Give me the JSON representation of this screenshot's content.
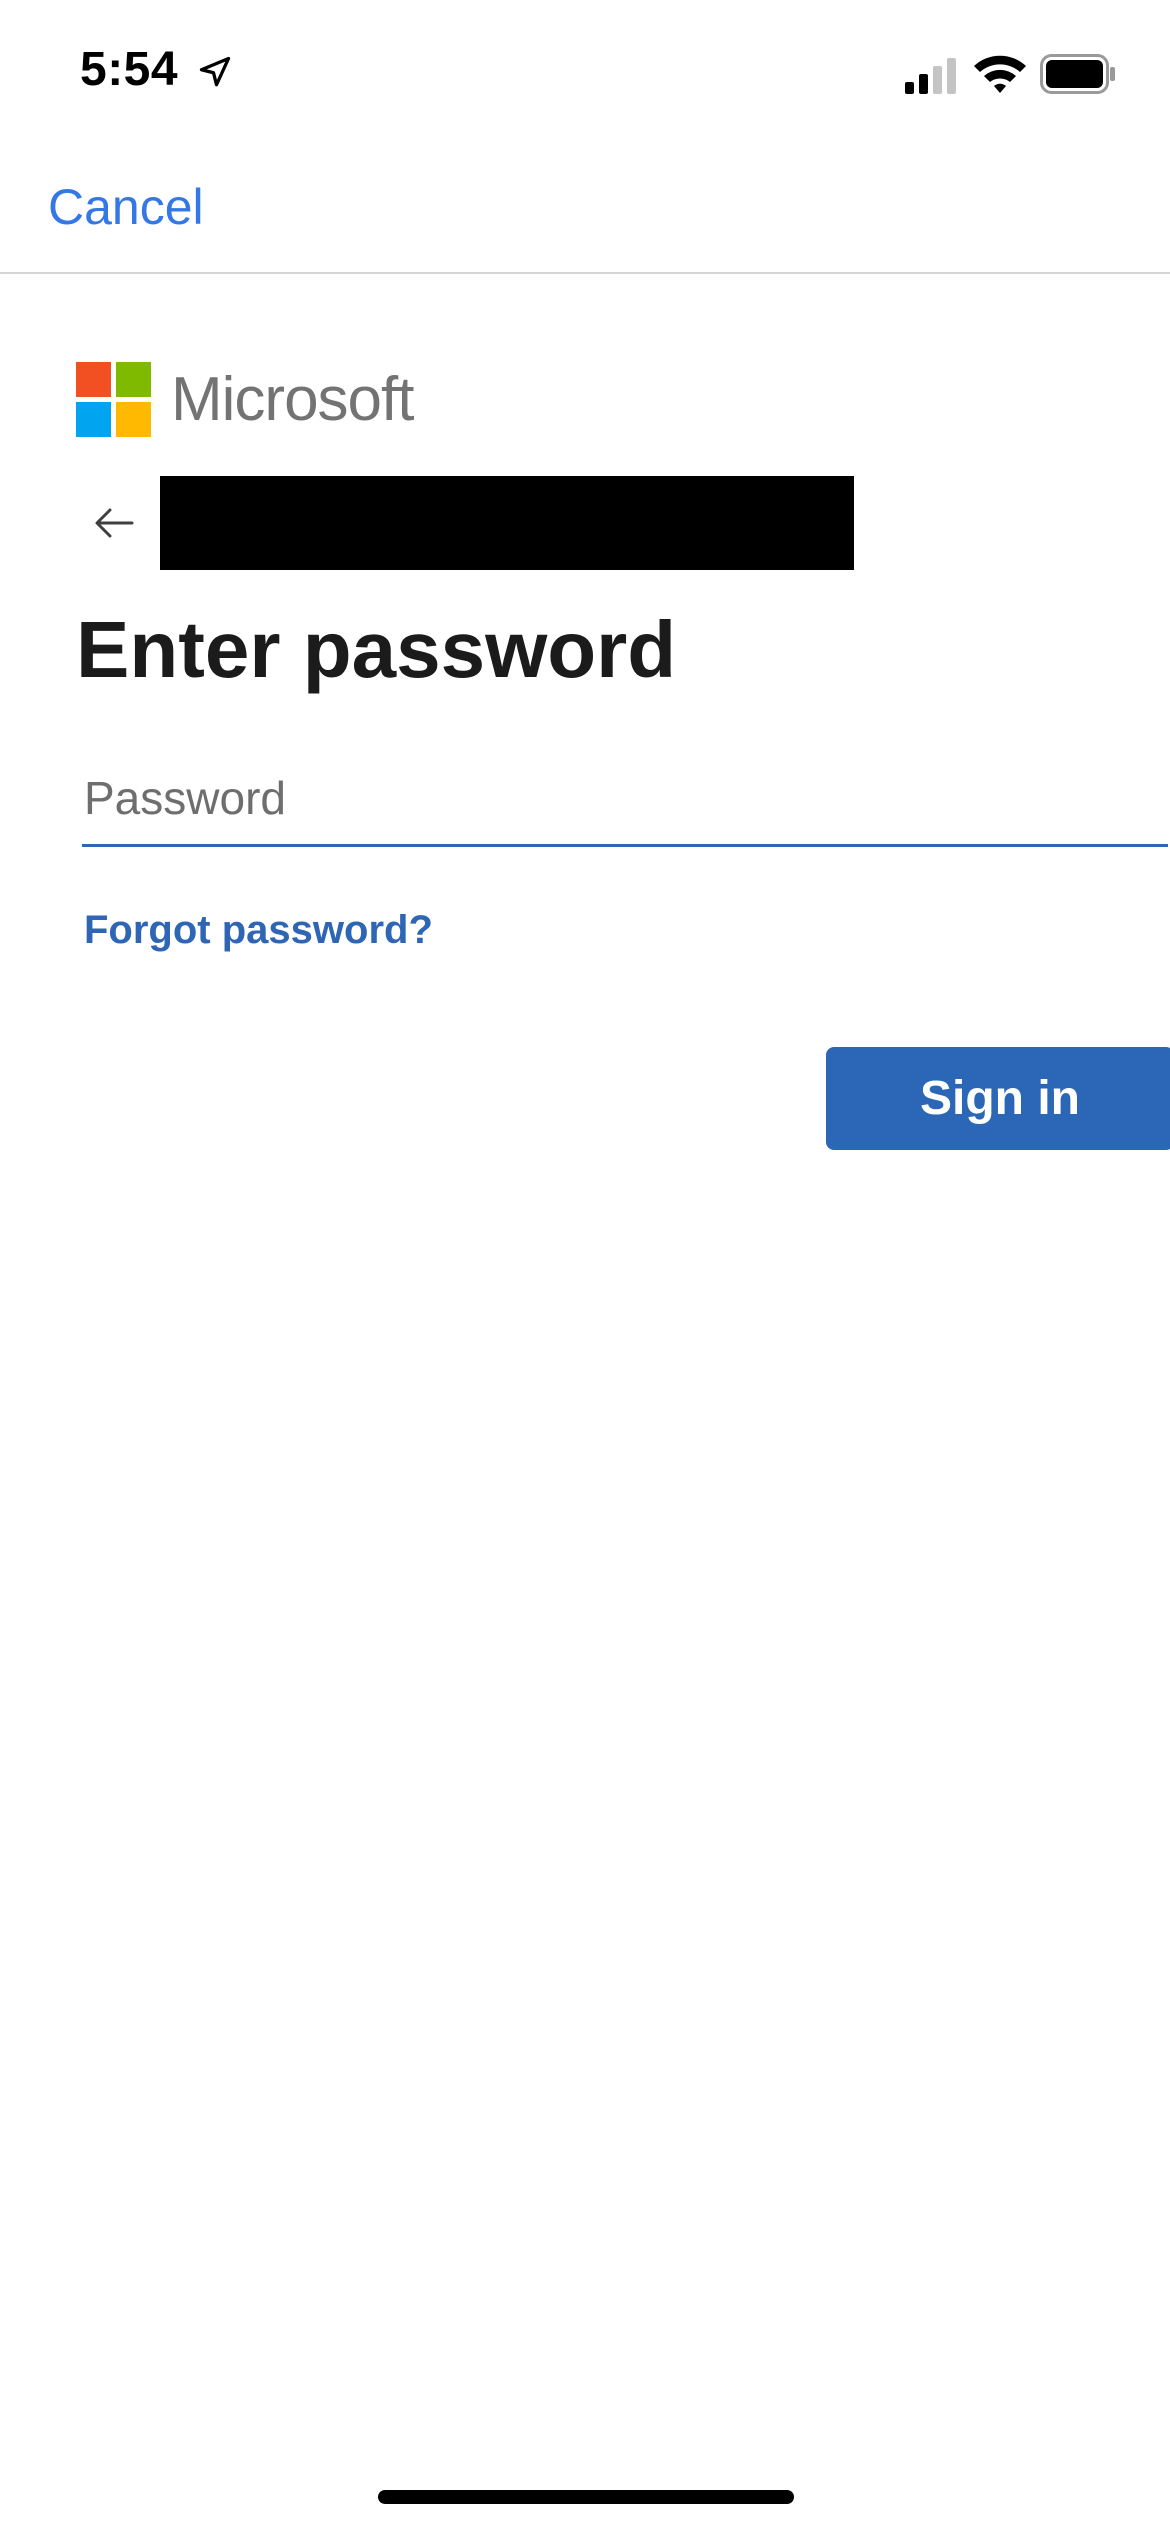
{
  "status_bar": {
    "time": "5:54",
    "location_icon": "location-arrow-icon",
    "signal_icon": "cellular-signal-icon",
    "wifi_icon": "wifi-icon",
    "battery_icon": "battery-icon"
  },
  "nav": {
    "cancel_label": "Cancel"
  },
  "brand": {
    "wordmark": "Microsoft",
    "logo_colors": [
      "#f25022",
      "#7fba00",
      "#00a4ef",
      "#ffb900"
    ]
  },
  "identity": {
    "back_icon": "back-arrow-icon",
    "email_redacted": true
  },
  "form": {
    "title": "Enter password",
    "password_placeholder": "Password",
    "password_value": "",
    "forgot_label": "Forgot password?",
    "signin_label": "Sign in"
  },
  "colors": {
    "ios_link": "#3478e6",
    "primary_button": "#2b67b6",
    "link": "#2e66b5"
  }
}
